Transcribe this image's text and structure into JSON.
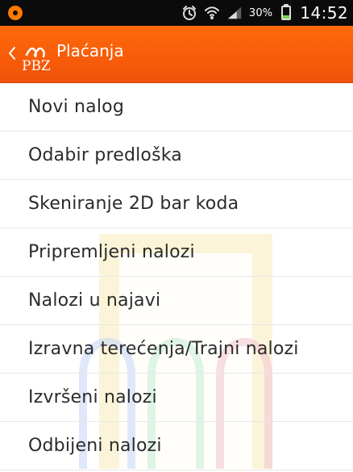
{
  "status_bar": {
    "battery_text": "30%",
    "battery_level": 0.3,
    "time": "14:52",
    "icons": [
      "app-notification-icon",
      "alarm-icon",
      "wifi-icon",
      "signal-icon",
      "battery-icon"
    ]
  },
  "action_bar": {
    "title": "Plaćanja",
    "logo_text": "PBZ",
    "accent_color": "#ff6a0a"
  },
  "menu": {
    "items": [
      {
        "label": "Novi nalog"
      },
      {
        "label": "Odabir predloška"
      },
      {
        "label": "Skeniranje 2D bar koda"
      },
      {
        "label": "Pripremljeni nalozi"
      },
      {
        "label": "Nalozi u najavi"
      },
      {
        "label": "Izravna terećenja/Trajni nalozi"
      },
      {
        "label": "Izvršeni nalozi"
      },
      {
        "label": "Odbijeni nalozi"
      }
    ]
  }
}
